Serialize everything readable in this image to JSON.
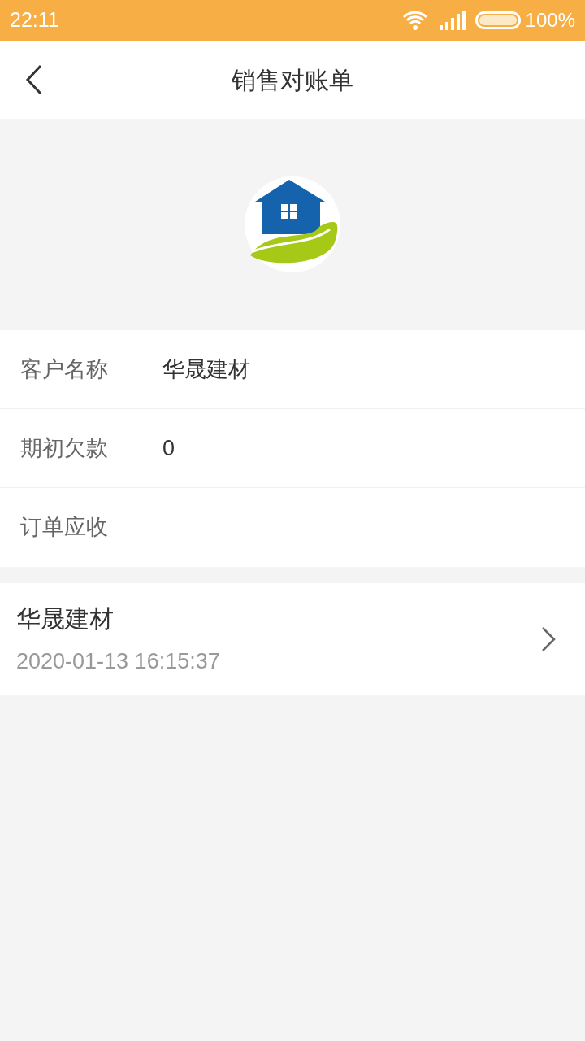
{
  "status_bar": {
    "time": "22:11",
    "battery": "100%"
  },
  "header": {
    "title": "销售对账单"
  },
  "info_rows": [
    {
      "label": "客户名称",
      "value": "华晟建材"
    },
    {
      "label": "期初欠款",
      "value": "0"
    },
    {
      "label": "订单应收"
    }
  ],
  "orders": [
    {
      "name": "华晟建材",
      "time": "2020-01-13 16:15:37"
    }
  ]
}
